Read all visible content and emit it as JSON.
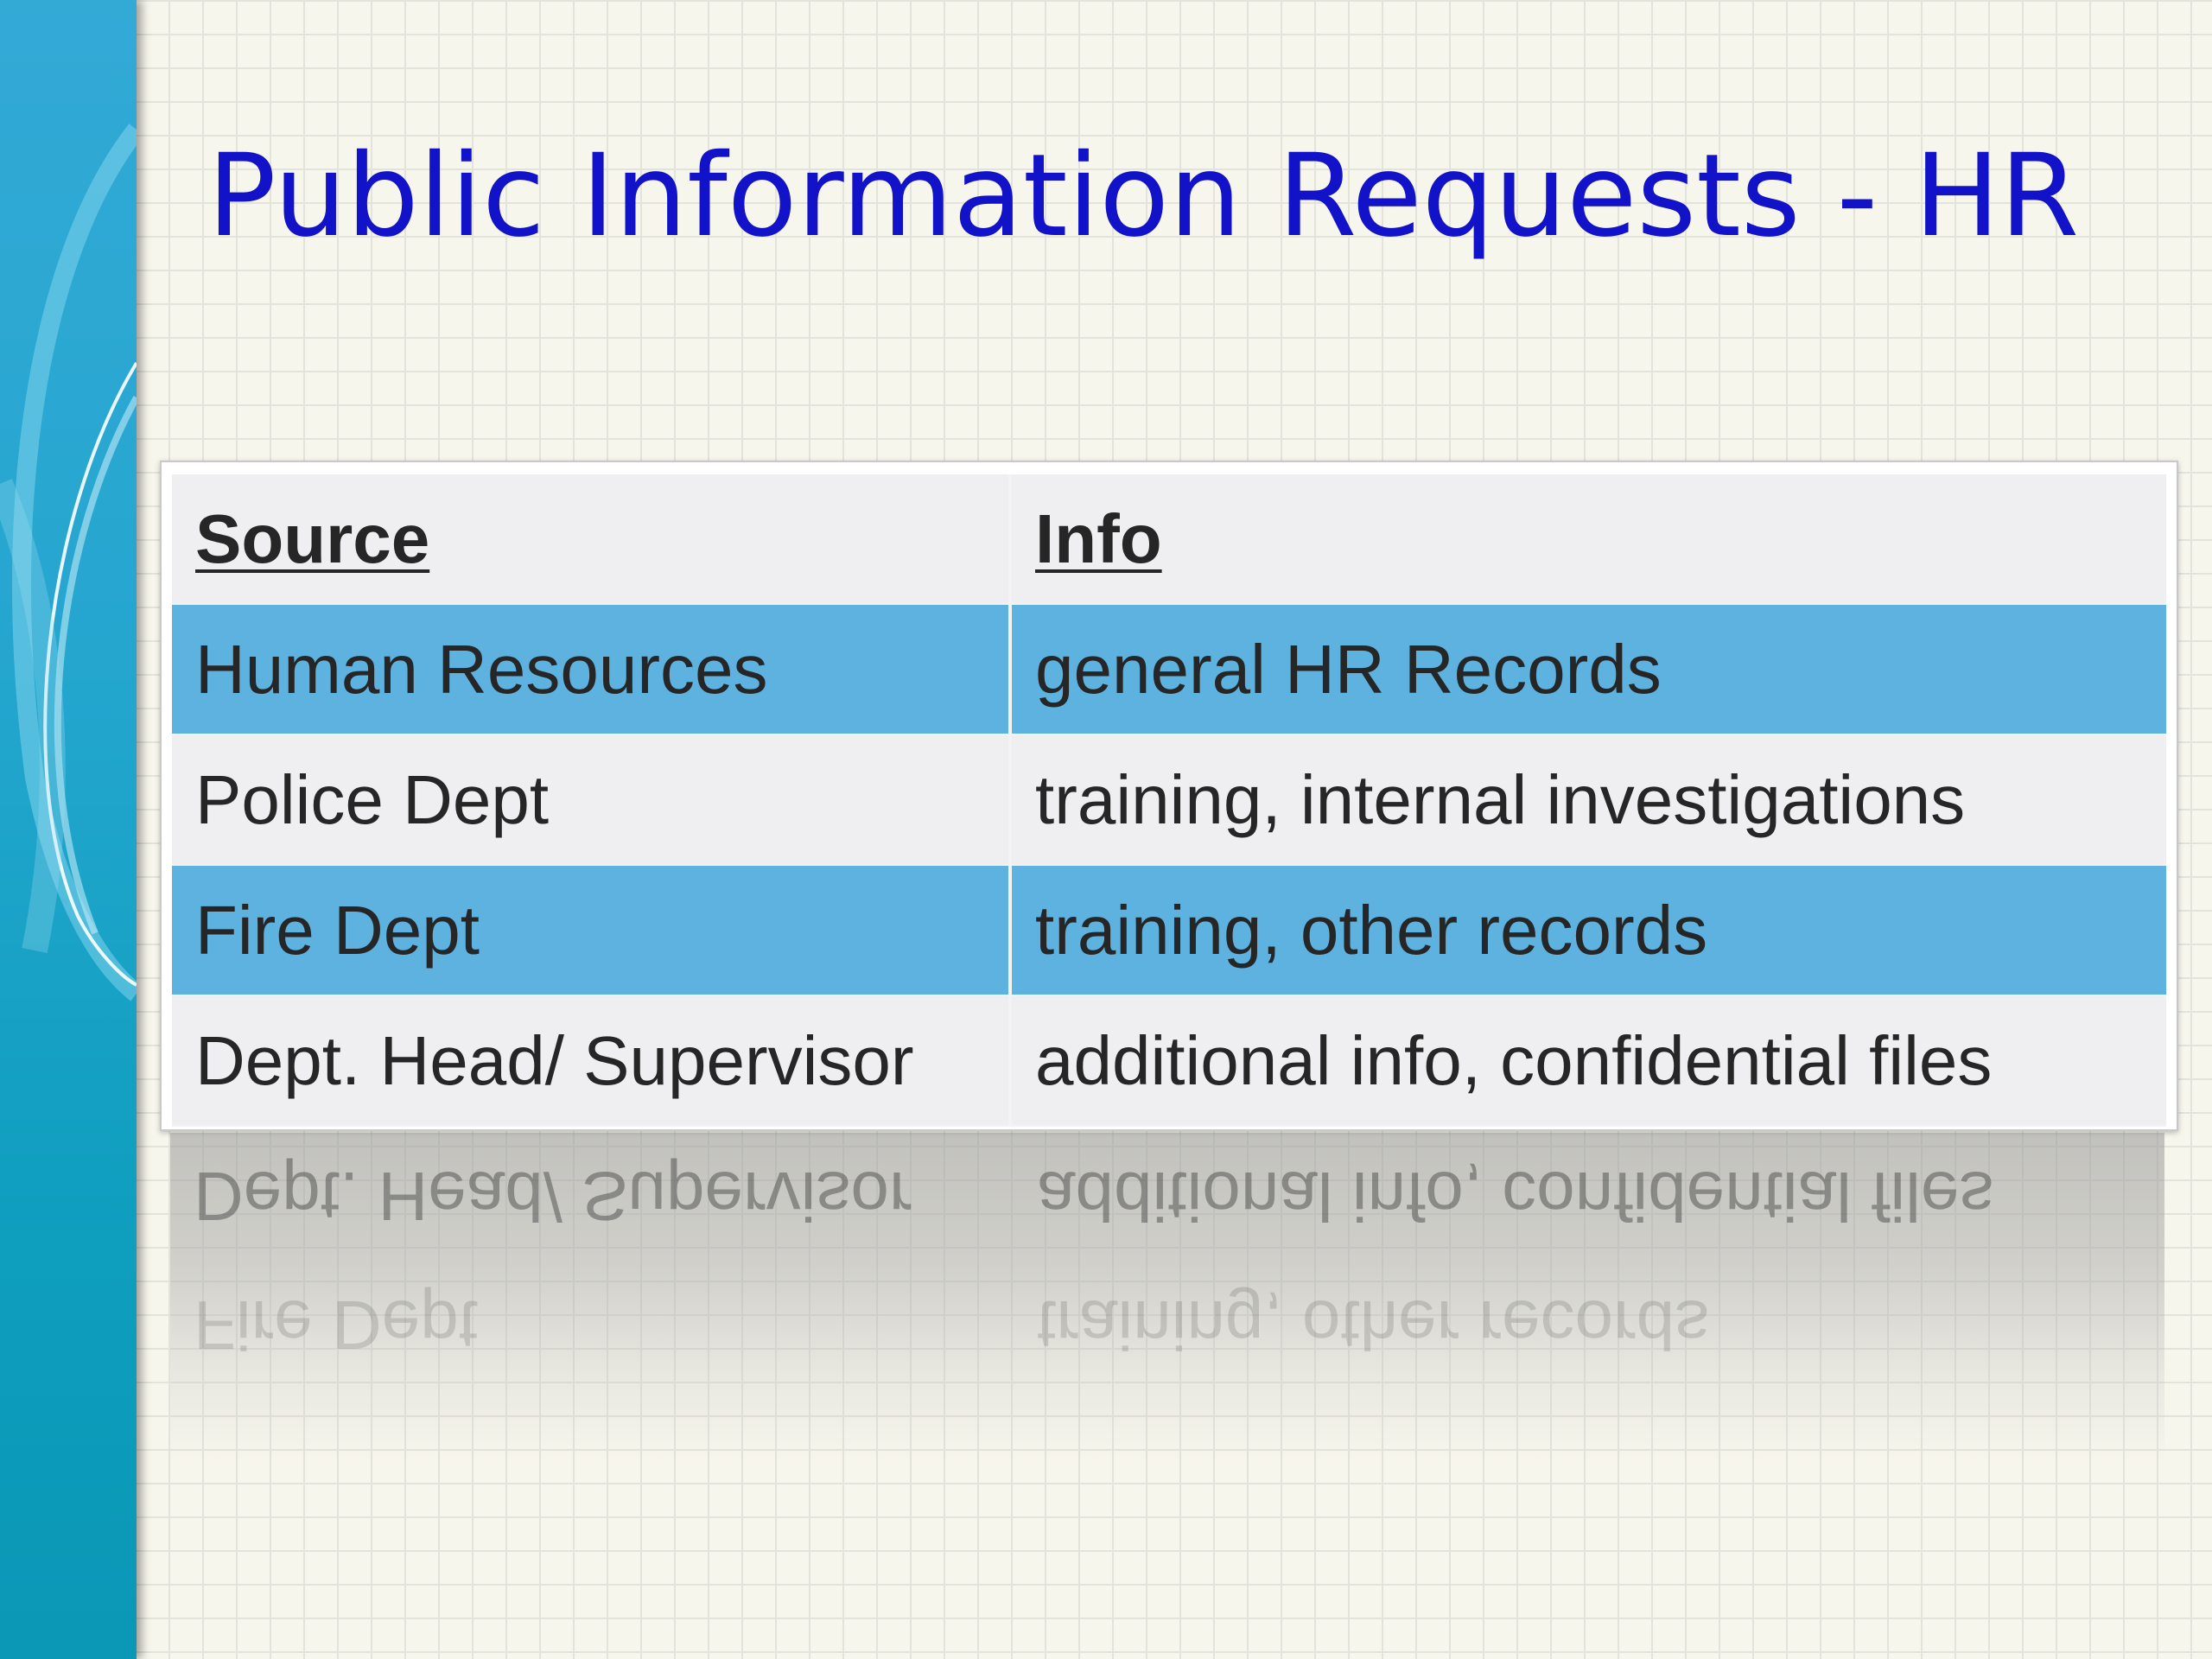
{
  "slide": {
    "title": "Public Information Requests - HR"
  },
  "table": {
    "headers": [
      "Source",
      "Info"
    ],
    "rows": [
      [
        "Human Resources",
        "general HR Records"
      ],
      [
        "Police Dept",
        "training, internal investigations"
      ],
      [
        "Fire Dept",
        "training, other records"
      ],
      [
        "Dept. Head/ Supervisor",
        "additional info, confidential files"
      ]
    ]
  },
  "colors": {
    "title": "#1212c8",
    "row_blue": "#5db2e0",
    "row_light": "#efeef1",
    "side_band": "#24a6cf",
    "background": "#f7f6ec"
  }
}
